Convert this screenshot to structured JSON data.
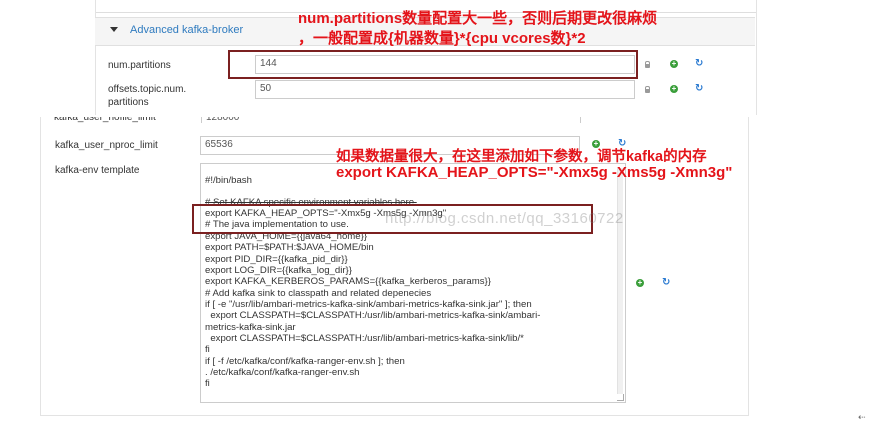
{
  "broker_section": {
    "title": "Advanced kafka-broker",
    "props": [
      {
        "label": "num.partitions",
        "value": "144"
      },
      {
        "label": "offsets.topic.num.\npartitions",
        "value": "50"
      }
    ]
  },
  "env_section": {
    "partial_label": "kafka_user_nofile_limit",
    "partial_value": "128000",
    "props": [
      {
        "label": "kafka_user_nproc_limit",
        "value": "65536"
      }
    ],
    "template_label": "kafka-env template",
    "template_lines": [
      "#!/bin/bash",
      "",
      "# Set KAFKA specific environment variables here.",
      "export KAFKA_HEAP_OPTS=\"-Xmx5g -Xms5g -Xmn3g\"",
      "# The java implementation to use.",
      "export JAVA_HOME={{java64_home}}",
      "export PATH=$PATH:$JAVA_HOME/bin",
      "export PID_DIR={{kafka_pid_dir}}",
      "export LOG_DIR={{kafka_log_dir}}",
      "export KAFKA_KERBEROS_PARAMS={{kafka_kerberos_params}}",
      "# Add kafka sink to classpath and related depenecies",
      "if [ -e \"/usr/lib/ambari-metrics-kafka-sink/ambari-metrics-kafka-sink.jar\" ]; then",
      "  export CLASSPATH=$CLASSPATH:/usr/lib/ambari-metrics-kafka-sink/ambari-",
      "metrics-kafka-sink.jar",
      "  export CLASSPATH=$CLASSPATH:/usr/lib/ambari-metrics-kafka-sink/lib/*",
      "fi",
      "if [ -f /etc/kafka/conf/kafka-ranger-env.sh ]; then",
      ". /etc/kafka/conf/kafka-ranger-env.sh",
      "fi"
    ]
  },
  "annotations": {
    "top_line1": "num.partitions数量配置大一些，否则后期更改很麻烦",
    "top_line2": "，一般配置成{机器数量}*{cpu vcores数}*2",
    "mid_line1": "如果数据量很大，在这里添加如下参数，调节kafka的内存",
    "mid_line2": "export KAFKA_HEAP_OPTS=\"-Xmx5g -Xms5g -Xmn3g\""
  },
  "watermark": "http://blog.csdn.net/qq_33160722",
  "icons": {
    "lock": "lock-icon",
    "plus": "plus-circle-icon",
    "refresh": "refresh-icon",
    "caret": "caret-down-icon"
  },
  "colors": {
    "annotation": "#e4141a",
    "highlight_box": "#7b2020",
    "link": "#2f7bbf",
    "plus": "#3a9e3a",
    "refresh": "#2a7ad1"
  }
}
